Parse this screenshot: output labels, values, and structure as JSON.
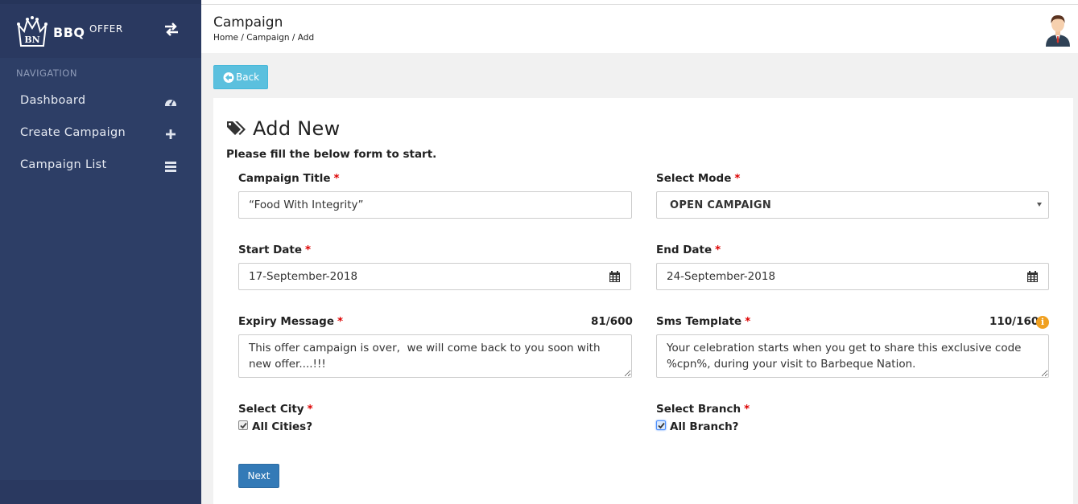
{
  "brand": {
    "logo_text": "BN",
    "name": "BBQ",
    "superscript": "OFFER"
  },
  "sidebar": {
    "heading": "NAVIGATION",
    "items": [
      {
        "label": "Dashboard",
        "icon": "dashboard-icon"
      },
      {
        "label": "Create Campaign",
        "icon": "plus-icon"
      },
      {
        "label": "Campaign List",
        "icon": "list-icon"
      }
    ]
  },
  "header": {
    "title": "Campaign",
    "breadcrumb": [
      "Home",
      "Campaign",
      "Add"
    ],
    "breadcrumb_sep": " / "
  },
  "back_button": {
    "label": "Back"
  },
  "form": {
    "title": "Add New",
    "subtitle": "Please fill the below form to start.",
    "campaign_title": {
      "label": "Campaign Title",
      "value": "“Food With Integrity”"
    },
    "mode": {
      "label": "Select Mode",
      "value": "OPEN CAMPAIGN"
    },
    "start_date": {
      "label": "Start Date",
      "value": "17-September-2018"
    },
    "end_date": {
      "label": "End Date",
      "value": "24-September-2018"
    },
    "expiry_message": {
      "label": "Expiry Message",
      "counter": "81/600",
      "value": "This offer campaign is over,  we will come back to you soon with new offer....!!!"
    },
    "sms_template": {
      "label": "Sms Template",
      "counter": "110/160",
      "value": "Your celebration starts when you get to share this exclusive code %cpn%, during your visit to Barbeque Nation."
    },
    "city": {
      "label": "Select City",
      "checkbox_label": "All Cities?",
      "checked": true
    },
    "branch": {
      "label": "Select Branch",
      "checkbox_label": "All Branch?",
      "checked": true
    },
    "required_mark": "*",
    "next_label": "Next"
  },
  "colors": {
    "sidebar": "#2d3e66",
    "back_button": "#5bc0de",
    "next_button": "#337ab7",
    "required": "#dd0000",
    "info": "#f0a020"
  }
}
